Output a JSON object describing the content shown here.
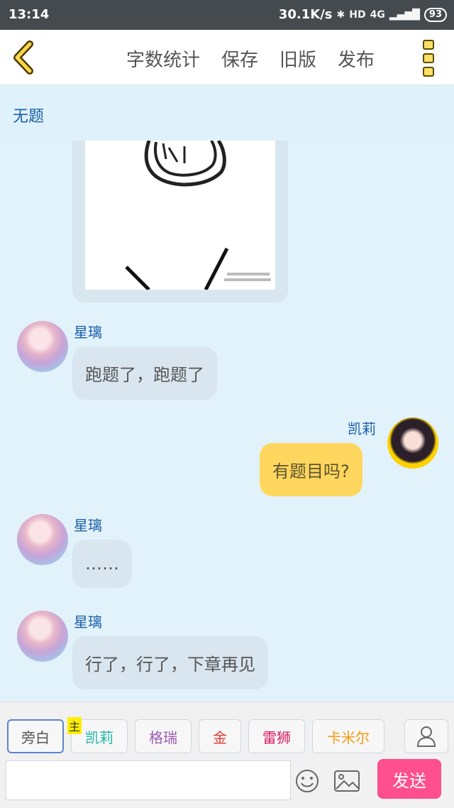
{
  "status_bar": {
    "time": "13:14",
    "speed": "30.1K/s",
    "hd": "HD",
    "net": "4G",
    "battery": "93"
  },
  "toolbar": {
    "items": [
      "字数统计",
      "保存",
      "旧版",
      "发布"
    ]
  },
  "title": "无题",
  "messages": [
    {
      "sender": "星璃",
      "text": "跑题了，跑题了",
      "side": "left"
    },
    {
      "sender": "凯莉",
      "text": "有题目吗?",
      "side": "right"
    },
    {
      "sender": "星璃",
      "text": "……",
      "side": "left"
    },
    {
      "sender": "星璃",
      "text": "行了，行了，下章再见",
      "side": "left"
    }
  ],
  "characters": [
    {
      "label": "旁白",
      "color": "#555555"
    },
    {
      "label": "凯莉",
      "color": "#22b5a6",
      "badge": "主"
    },
    {
      "label": "格瑞",
      "color": "#9b59b6"
    },
    {
      "label": "金",
      "color": "#e53935"
    },
    {
      "label": "雷狮",
      "color": "#d81b60"
    },
    {
      "label": "卡米尔",
      "color": "#f39c12"
    }
  ],
  "send_button": "发送"
}
